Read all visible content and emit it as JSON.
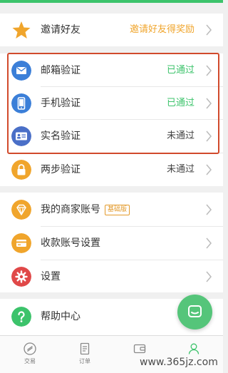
{
  "colors": {
    "accent": "#3cc36b",
    "passed": "#3cc36b",
    "invite": "#f0a52c",
    "highlight": "#d14a2c"
  },
  "invite": {
    "label": "邀请好友",
    "value": "邀请好友得奖励",
    "icon": "star-icon"
  },
  "verify": [
    {
      "label": "邮箱验证",
      "value": "已通过",
      "status": "passed",
      "icon": "email-icon"
    },
    {
      "label": "手机验证",
      "value": "已通过",
      "status": "passed",
      "icon": "phone-icon"
    },
    {
      "label": "实名验证",
      "value": "未通过",
      "status": "failed",
      "icon": "id-card-icon"
    },
    {
      "label": "两步验证",
      "value": "未通过",
      "status": "failed",
      "icon": "lock-icon"
    }
  ],
  "account": [
    {
      "label": "我的商家账号",
      "badge": "基础版",
      "icon": "diamond-icon"
    },
    {
      "label": "收款账号设置",
      "icon": "card-icon"
    },
    {
      "label": "设置",
      "icon": "gear-icon"
    }
  ],
  "help": {
    "label": "帮助中心",
    "icon": "question-icon"
  },
  "tabs": [
    {
      "label": "交易",
      "icon": "trade-icon"
    },
    {
      "label": "订单",
      "icon": "order-icon"
    },
    {
      "label": "",
      "icon": "wallet-icon"
    },
    {
      "label": "",
      "icon": "user-icon"
    }
  ],
  "watermark": "www.365jz.com"
}
